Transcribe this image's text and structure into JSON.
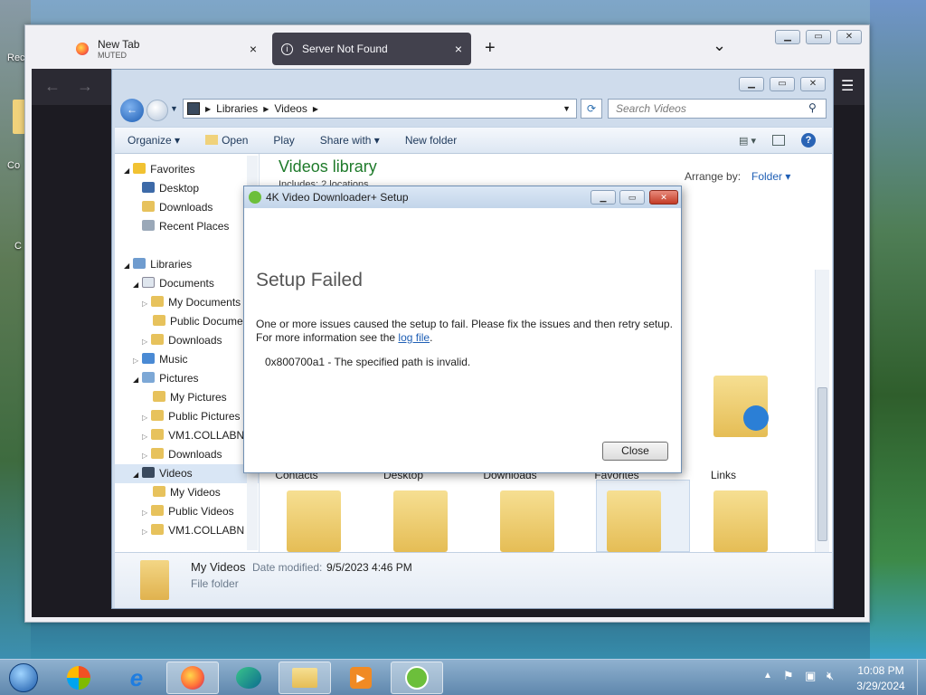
{
  "desktop": {
    "labels": [
      "Rec",
      "Co",
      "C"
    ]
  },
  "firefox": {
    "tabs": [
      {
        "title": "New Tab",
        "subtitle": "MUTED"
      },
      {
        "title": "Server Not Found"
      }
    ],
    "new_tab": "+",
    "list_all": "⌄",
    "close_glyph": "×",
    "menu_glyph": "☰"
  },
  "explorer": {
    "breadcrumb": [
      "Libraries",
      "Videos"
    ],
    "search_placeholder": "Search Videos",
    "toolbar": {
      "organize": "Organize",
      "open": "Open",
      "play": "Play",
      "share_with": "Share with",
      "new_folder": "New folder"
    },
    "nav": {
      "favorites": "Favorites",
      "favorites_items": [
        "Desktop",
        "Downloads",
        "Recent Places"
      ],
      "libraries": "Libraries",
      "documents": "Documents",
      "documents_items": [
        "My Documents",
        "Public Docume"
      ],
      "downloads": "Downloads",
      "music": "Music",
      "pictures": "Pictures",
      "pictures_items": [
        "My Pictures",
        "Public Pictures",
        "VM1.COLLABN",
        "Downloads"
      ],
      "videos": "Videos",
      "videos_items": [
        "My Videos",
        "Public Videos",
        "VM1.COLLABN"
      ]
    },
    "library_title": "Videos library",
    "library_sub": "Includes: 2 locations",
    "arrange_by_label": "Arrange by:",
    "arrange_by_value": "Folder",
    "folder_labels": [
      "Contacts",
      "Desktop",
      "Downloads",
      "Favorites",
      "Links"
    ],
    "details": {
      "name": "My Videos",
      "date_label": "Date modified:",
      "date_value": "9/5/2023 4:46 PM",
      "type": "File folder"
    }
  },
  "dialog": {
    "title": "4K Video Downloader+ Setup",
    "heading": "Setup Failed",
    "message_line1": "One or more issues caused the setup to fail. Please fix the issues and then retry setup.",
    "message_line2_prefix": "For more information see the ",
    "log_link": "log file",
    "message_line2_suffix": ".",
    "error": "0x800700a1 - The specified path is invalid.",
    "close_button": "Close"
  },
  "taskbar": {
    "time": "10:08 PM",
    "date": "3/29/2024"
  }
}
